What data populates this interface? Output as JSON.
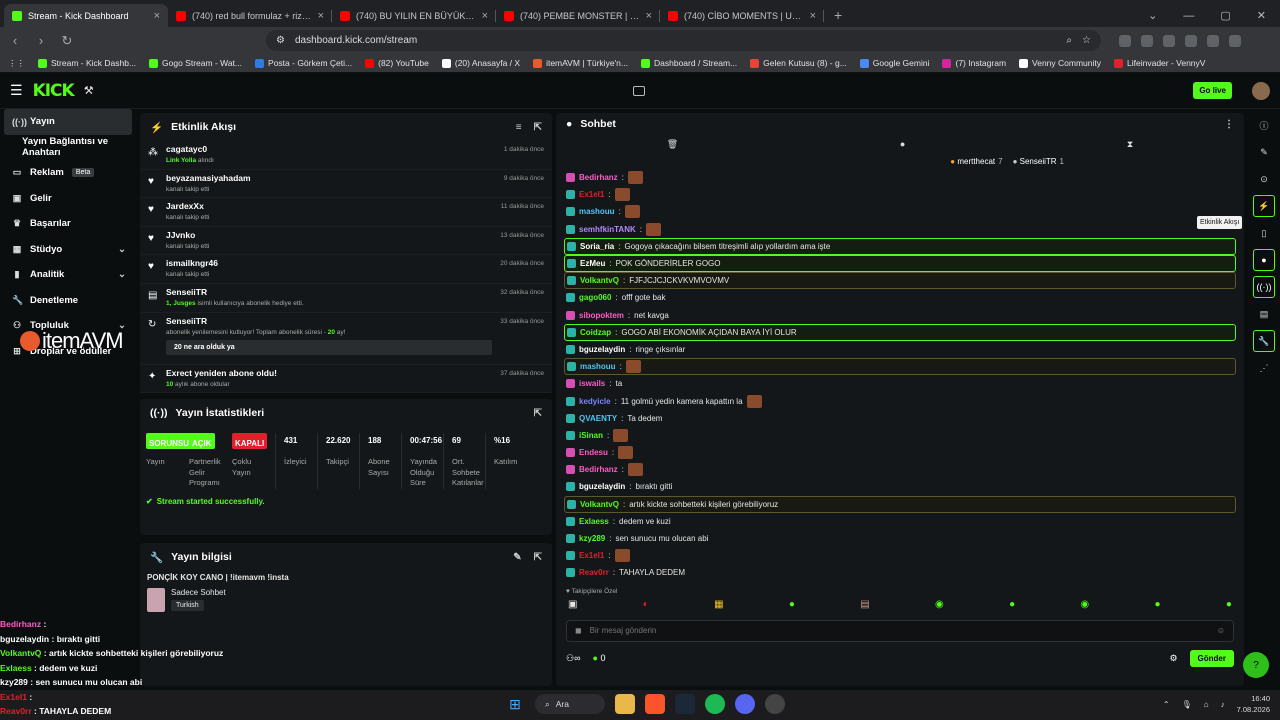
{
  "browser": {
    "tabs": [
      {
        "title": "Stream - Kick Dashboard",
        "color": "#53fc18",
        "active": true
      },
      {
        "title": "(740) red bull formulaz + rize vlog -",
        "color": "#ff0000"
      },
      {
        "title": "(740) BU YILIN EN BÜYÜK DRAMASI",
        "color": "#ff0000"
      },
      {
        "title": "(740) PEMBE MONSTER | Madara Ot",
        "color": "#ff0000"
      },
      {
        "title": "(740) CİBO MOMENTS | ULTRA HIZLI",
        "color": "#ff0000"
      }
    ],
    "url": "dashboard.kick.com/stream",
    "bookmarks": [
      {
        "label": "Stream - Kick Dashb...",
        "color": "#53fc18"
      },
      {
        "label": "Gogo Stream - Wat...",
        "color": "#53fc18"
      },
      {
        "label": "Posta - Görkem Çeti...",
        "color": "#2d7be5"
      },
      {
        "label": "(82) YouTube",
        "color": "#ff0000"
      },
      {
        "label": "(20) Anasayfa / X",
        "color": "#ffffff"
      },
      {
        "label": "itemAVM | Türkiye'n...",
        "color": "#e95b2c"
      },
      {
        "label": "Dashboard / Stream...",
        "color": "#53fc18"
      },
      {
        "label": "Gelen Kutusu (8) - g...",
        "color": "#ea4335"
      },
      {
        "label": "Google Gemini",
        "color": "#4a8af4"
      },
      {
        "label": "(7) Instagram",
        "color": "#d6249f"
      },
      {
        "label": "Venny Community",
        "color": "#ffffff"
      },
      {
        "label": "Lifeinvader - VennyV",
        "color": "#e0202a"
      }
    ]
  },
  "header": {
    "logo": "KICK",
    "go_live": "Go live"
  },
  "sidebar": {
    "items": [
      {
        "label": "Yayın",
        "icon": "radio-icon"
      },
      {
        "label": "Yayın Bağlantısı ve Anahtarı",
        "icon": ""
      },
      {
        "label": "Reklam",
        "icon": "ad-icon",
        "badge": "Beta"
      },
      {
        "label": "Gelir",
        "icon": "money-icon"
      },
      {
        "label": "Başarılar",
        "icon": "trophy-icon"
      },
      {
        "label": "Stüdyo",
        "icon": "studio-icon"
      },
      {
        "label": "Analitik",
        "icon": "chart-icon"
      },
      {
        "label": "Denetleme",
        "icon": "wrench-icon"
      },
      {
        "label": "Topluluk",
        "icon": "community-icon"
      },
      {
        "label": "Droplar ve ödüller",
        "icon": "gift-icon"
      }
    ]
  },
  "overlay": {
    "logo": "itemAVM",
    "chat": [
      {
        "user": "Bedirhanz",
        "text": "",
        "color": "#ff5ac8"
      },
      {
        "user": "bguzelaydin",
        "text": "bıraktı gitti",
        "color": "#ffffff"
      },
      {
        "user": "VolkantvQ",
        "text": "artık kickte sohbetteki kişileri görebiliyoruz",
        "color": "#53fc18"
      },
      {
        "user": "Exlaess",
        "text": "dedem ve kuzi",
        "color": "#53fc18"
      },
      {
        "user": "kzy289",
        "text": "sen sunucu mu olucan abi",
        "color": "#ffffff"
      },
      {
        "user": "Ex1eI1",
        "text": "",
        "color": "#e0202a"
      },
      {
        "user": "Reav0rr",
        "text": "TAHAYLA DEDEM",
        "color": "#e0202a"
      }
    ]
  },
  "activity": {
    "title": "Etkinlik Akışı",
    "events": [
      {
        "name": "cagatayc0",
        "desc_green": "Link Yolla",
        "desc": " alındı",
        "time": "1 dakika önce",
        "icon": "gift-icon"
      },
      {
        "name": "beyazamasiyahadam",
        "desc": "kanalı takip etti",
        "time": "9 dakika önce",
        "icon": "heart-icon"
      },
      {
        "name": "JardexXx",
        "desc": "kanalı takip etti",
        "time": "11 dakika önce",
        "icon": "heart-icon"
      },
      {
        "name": "JJvnko",
        "desc": "kanalı takip etti",
        "time": "13 dakika önce",
        "icon": "heart-icon"
      },
      {
        "name": "ismailkngr46",
        "desc": "kanalı takip etti",
        "time": "20 dakika önce",
        "icon": "heart-icon"
      },
      {
        "name": "SenseiiTR",
        "desc_green": "1, Jusges",
        "desc": " isimli kullanıcıya abonelik hediye etti.",
        "time": "32 dakika önce",
        "icon": "sub-icon"
      },
      {
        "name": "SenseiiTR",
        "desc": "abonelik yenilemesini kutluyor! Toplam abonelik süresi - ",
        "desc_green2": "20",
        "desc_tail": " ay!",
        "quote": "20 ne ara olduk ya",
        "time": "33 dakika önce",
        "icon": "refresh-icon"
      },
      {
        "name": "Exrect yeniden abone oldu!",
        "desc_green": "10",
        "desc": " aylık abone oldular",
        "time": "37 dakika önce",
        "icon": "star-icon"
      }
    ]
  },
  "stats": {
    "title": "Yayın İstatistikleri",
    "items": [
      {
        "value": "SORUNSUZ",
        "label": "Yayın",
        "badge": "green"
      },
      {
        "value": "AÇIK",
        "label": "Partnerlik Gelir Programı",
        "badge": "green"
      },
      {
        "value": "KAPALI",
        "label": "Çoklu Yayın",
        "badge": "red"
      },
      {
        "value": "431",
        "label": "İzleyici"
      },
      {
        "value": "22.620",
        "label": "Takipçi"
      },
      {
        "value": "188",
        "label": "Abone Sayısı"
      },
      {
        "value": "00:47:56",
        "label": "Yayında Olduğu Süre"
      },
      {
        "value": "69",
        "label": "Ort. Sohbete Katılanlar"
      },
      {
        "value": "%16",
        "label": "Katılım"
      }
    ],
    "success": "Stream started successfully."
  },
  "info": {
    "title": "Yayın bilgisi",
    "stream_title": "PONÇİK KOY CANO | !itemavm !insta",
    "category": "Sadece Sohbet",
    "tag": "Turkish"
  },
  "chat": {
    "title": "Sohbet",
    "pinned": [
      {
        "user": "mertthecat",
        "count": "7"
      },
      {
        "user": "SenseiiTR",
        "count": "1"
      }
    ],
    "messages": [
      {
        "user": "Bedirhanz",
        "text": "",
        "color": "#ff5ac8",
        "emote": true,
        "style": ""
      },
      {
        "user": "Ex1eI1",
        "text": "",
        "color": "#e0202a",
        "emote": true,
        "style": ""
      },
      {
        "user": "mashouu",
        "text": "",
        "color": "#4fc3f7",
        "emote": true,
        "style": ""
      },
      {
        "user": "semhfkinTANK",
        "text": "",
        "color": "#b388ff",
        "emote": true,
        "style": ""
      },
      {
        "user": "Soria_ria",
        "text": "Gogoya çıkacağını bilsem titreşimli alıp yollardım ama işte",
        "color": "#ffffff",
        "style": "hl"
      },
      {
        "user": "EzMeu",
        "text": "POK GÖNDERİRLER GOGO",
        "color": "#ffffff",
        "style": "hl"
      },
      {
        "user": "VolkantvQ",
        "text": "FJFJCJCJCKVKVMVOVMV",
        "color": "#53fc18",
        "style": "hl2"
      },
      {
        "user": "gago060",
        "text": "offf gote bak",
        "color": "#53fc18",
        "style": ""
      },
      {
        "user": "sibopoktem",
        "text": "net kavga",
        "color": "#ff5ac8",
        "style": ""
      },
      {
        "user": "Coidzap",
        "text": "GOGO ABİ EKONOMİK AÇIDAN BAYA İYİ OLUR",
        "color": "#53fc18",
        "style": "hl"
      },
      {
        "user": "bguzelaydin",
        "text": "ringe çıksınlar",
        "color": "#ffffff",
        "style": ""
      },
      {
        "user": "mashouu",
        "text": "",
        "color": "#4fc3f7",
        "emote": true,
        "style": "hl2"
      },
      {
        "user": "iswails",
        "text": "ta",
        "color": "#ff5ac8",
        "style": ""
      },
      {
        "user": "kedyicle",
        "text": "11 golmü yedin kamera kapattın la",
        "color": "#7c83ff",
        "emote": true,
        "style": ""
      },
      {
        "user": "QVAENTY",
        "text": "Ta dedem",
        "color": "#4fc3f7",
        "style": ""
      },
      {
        "user": "iSinan",
        "text": "",
        "color": "#53fc18",
        "emote": true,
        "style": ""
      },
      {
        "user": "Endesu",
        "text": "",
        "color": "#ff5ac8",
        "emote": true,
        "style": ""
      },
      {
        "user": "Bedirhanz",
        "text": "",
        "color": "#ff5ac8",
        "emote": true,
        "style": ""
      },
      {
        "user": "bguzelaydin",
        "text": "bıraktı gitti",
        "color": "#ffffff",
        "style": ""
      },
      {
        "user": "VolkantvQ",
        "text": "artık kickte sohbetteki kişileri görebiliyoruz",
        "color": "#53fc18",
        "style": "hl2"
      },
      {
        "user": "Exlaess",
        "text": "dedem ve kuzi",
        "color": "#53fc18",
        "style": ""
      },
      {
        "user": "kzy289",
        "text": "sen sunucu mu olucan abi",
        "color": "#53fc18",
        "style": ""
      },
      {
        "user": "Ex1eI1",
        "text": "",
        "color": "#e0202a",
        "emote": true,
        "style": ""
      },
      {
        "user": "Reav0rr",
        "text": "TAHAYLA DEDEM",
        "color": "#e0202a",
        "style": ""
      }
    ],
    "followers_label": "Takipçilere Özel",
    "input_placeholder": "Bir mesaj gönderin",
    "points": "0",
    "send": "Gönder",
    "tooltip": "Etkinlik Akışı"
  },
  "taskbar": {
    "search": "Ara",
    "time": "16:40",
    "date": "7.08.2026"
  }
}
